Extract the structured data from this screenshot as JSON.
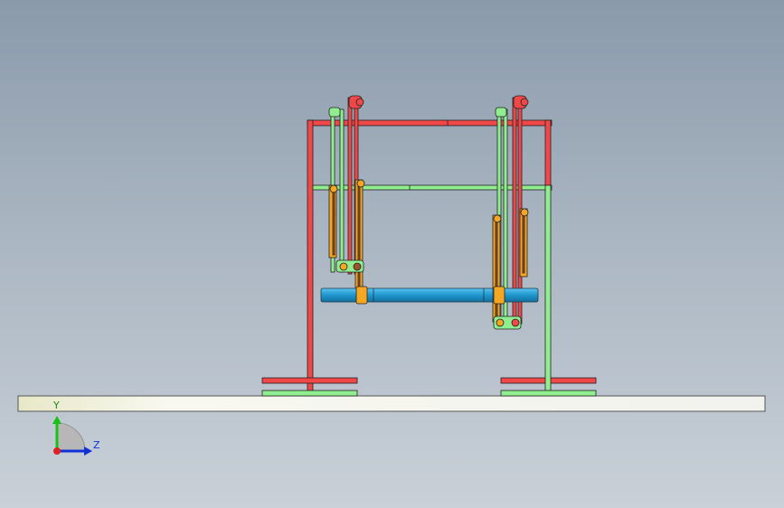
{
  "viewport": {
    "background_top": "#8a9aab",
    "background_bottom": "#c9d0d8"
  },
  "colors": {
    "frame_red": "#f04848",
    "frame_green": "#90ee90",
    "shaft_blue": "#2aa3d8",
    "link_orange": "#f5a623",
    "link_brown": "#a0522d",
    "ground_plate": "#f4f4f0"
  },
  "triad": {
    "y_label": "Y",
    "z_label": "Z",
    "y_color": "#18c018",
    "z_color": "#1030d8",
    "x_color": "#e02020"
  }
}
